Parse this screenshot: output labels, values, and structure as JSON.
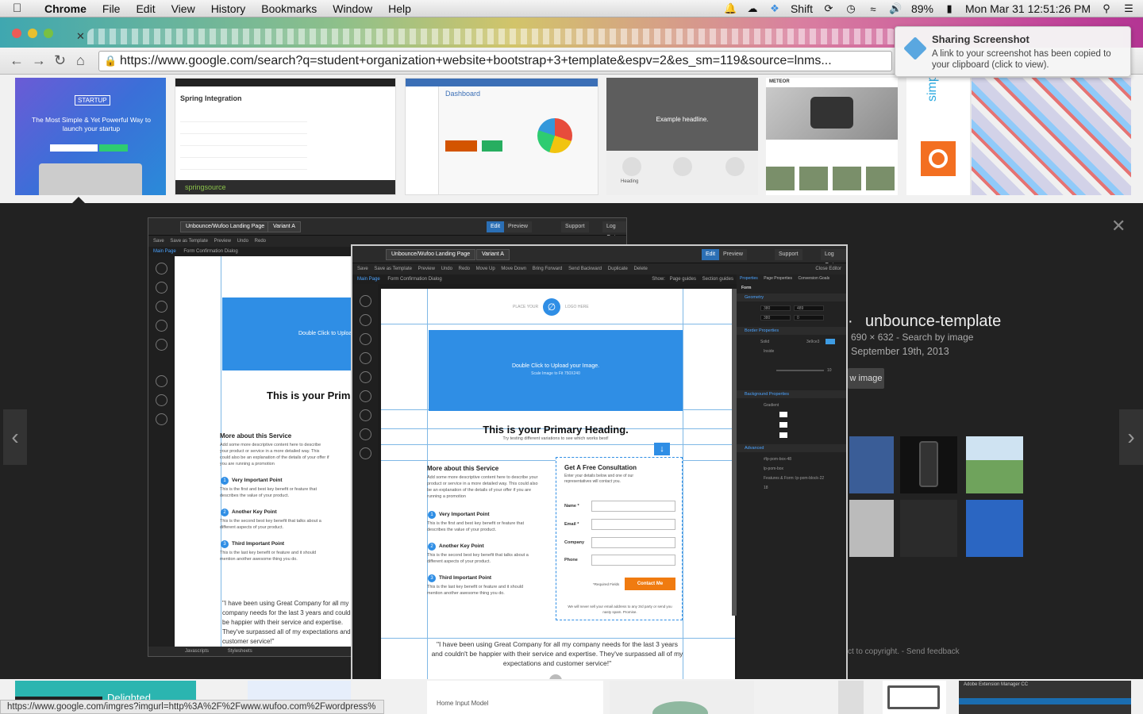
{
  "menubar": {
    "app": "Chrome",
    "menus": [
      "File",
      "Edit",
      "View",
      "History",
      "Bookmarks",
      "Window",
      "Help"
    ],
    "input_source": "Shift",
    "battery": "89%",
    "clock": "Mon Mar 31  12:51:26 PM"
  },
  "browser": {
    "url": "https://www.google.com/search?q=student+organization+website+bootstrap+3+template&espv=2&es_sm=119&source=lnms...",
    "status_url": "https://www.google.com/imgres?imgurl=http%3A%2F%2Fwww.wufoo.com%2Fwordpress%"
  },
  "notification": {
    "title": "Sharing Screenshot",
    "text": "A link to your screenshot has been copied to your clipboard (click to view)."
  },
  "thumbnails": {
    "t1_brand": "STARTUP",
    "t1_tagline": "The Most Simple & Yet Powerful Way to launch your startup",
    "t2_title": "Spring Integration",
    "t2_footer": "springsource",
    "t3_title": "Dashboard",
    "t4_headline": "Example headline.",
    "t4_heading": "Heading",
    "t5_brand": "METEOR",
    "t6_brand": "simple"
  },
  "preview": {
    "title": "unbounce-template",
    "dims": "690 × 632 - Search by image",
    "date": "September 19th, 2013",
    "view_image": "w image",
    "footer": "ct to copyright. - Send feedback"
  },
  "editor": {
    "page_name": "Unbounce/Wufoo Landing Page",
    "variant": "Variant A",
    "edit": "Edit",
    "preview": "Preview",
    "support": "Support",
    "logout": "Log Out",
    "tools": [
      "Save",
      "Save as Template",
      "Preview",
      "Undo",
      "Redo",
      "Move Up",
      "Move Down",
      "Bring Forward",
      "Send Backward",
      "Duplicate",
      "Delete"
    ],
    "close_editor": "Close Editor",
    "main_page": "Main Page",
    "form_dialog": "Form Confirmation Dialog",
    "show": "Show:",
    "page_guides": "Page guides",
    "section_guides": "Section guides",
    "logo_placeholder": "PLACE YOUR",
    "logo_here": "LOGO HERE",
    "hero_title": "Double Click to Upload your Image.",
    "hero_sub": "Scale Image to Fit 750X240",
    "primary_heading": "This is your Primary Heading.",
    "primary_sub": "Try testing different variations to see which works best!",
    "more_title": "More about this Service",
    "more_text": "Add some more descriptive content here to describe your product or service in a more detailed way. This could also be an explanation of the details of your offer if you are running a promotion",
    "points": [
      {
        "num": "1",
        "title": "Very Important Point",
        "text": "This is the first and best key benefit or feature that describes the value of your product."
      },
      {
        "num": "2",
        "title": "Another Key Point",
        "text": "This is the second best key benefit that talks about a different aspects of your product."
      },
      {
        "num": "3",
        "title": "Third Important Point",
        "text": "This is the last key benefit or feature and it should mention another awesome thing you do."
      }
    ],
    "form_title": "Get A Free Consultation",
    "form_sub": "Enter your details below and one of our representatives will contact you.",
    "fields": [
      "Name *",
      "Email *",
      "Company",
      "Phone"
    ],
    "required": "*Required Fields",
    "contact_btn": "Contact Me",
    "privacy": "We will never sell your email address to any 3rd party or send you nasty spam. Promise.",
    "quote": "\"I have been using Great Company for all my company needs for the last 3 years and couldn't be happier with their service and expertise. They've surpassed all of my expectations and customer service!\"",
    "javascripts": "Javascripts",
    "stylesheets": "Stylesheets",
    "tabs_right": [
      "Properties",
      "Page Properties",
      "Conversion Goals"
    ],
    "form_label": "Form",
    "geometry": "Geometry",
    "border_props": "Border Properties",
    "bg_props": "Background Properties",
    "advanced": "Advanced",
    "size_w": "380",
    "size_h": "489",
    "pos_l": "380",
    "pos_t": "0",
    "border_color": "3e9ce3",
    "border_style": "Solid",
    "location": "Inside",
    "fill": "Gradient",
    "id_value": "#lp-pom-box-48",
    "class_value": "lp-pom-box",
    "parent_value": "Features & Form: lp-pom-block-22",
    "zindex": "18",
    "corner_radius": "10"
  },
  "bottom_thumbs": {
    "b1": "Delighted",
    "b2": "Home Input Model",
    "b3": "Adobe Extension Manager CC"
  }
}
